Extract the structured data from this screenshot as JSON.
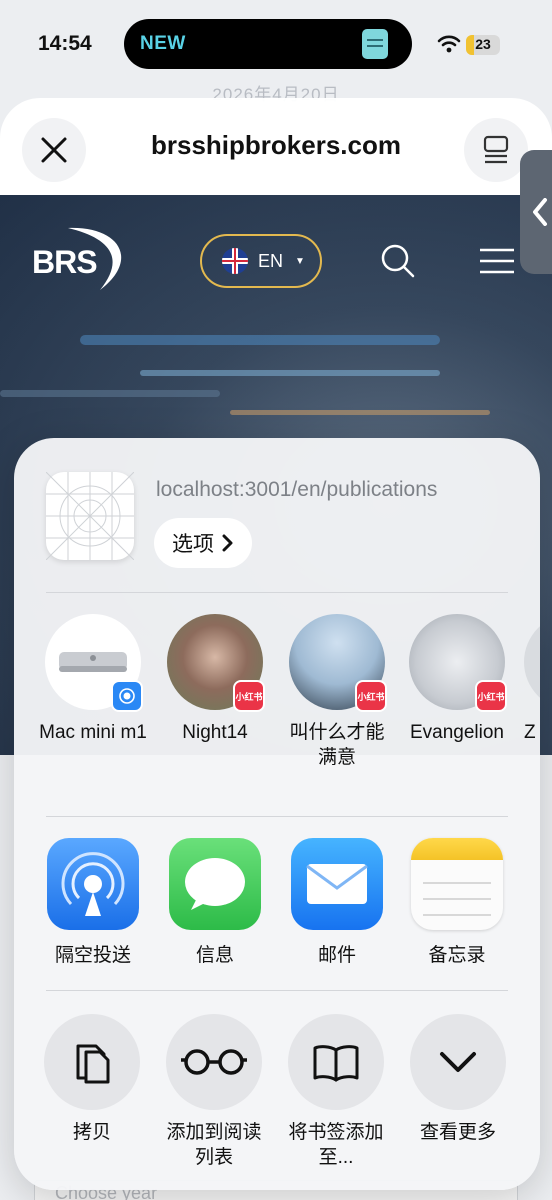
{
  "status_bar": {
    "time": "14:54",
    "island_label": "NEW",
    "battery": "23",
    "battery_level": 0.23
  },
  "background": {
    "date": "2026年4月20日",
    "bottom_field_placeholder": "Choose year"
  },
  "browser": {
    "domain": "brsshipbrokers.com"
  },
  "site_nav": {
    "logo_text": "BRS",
    "language": "EN"
  },
  "share_sheet": {
    "url": "localhost:3001/en/publications",
    "options_label": "选项",
    "contacts": [
      {
        "name": "Mac mini m1",
        "app": "airdrop"
      },
      {
        "name": "Night14",
        "app": "小红书"
      },
      {
        "name": "叫什么才能满意",
        "app": "小红书"
      },
      {
        "name": "Evangelion",
        "app": "小红书"
      },
      {
        "name": "Z"
      }
    ],
    "apps": [
      {
        "label": "隔空投送",
        "icon": "airdrop-icon"
      },
      {
        "label": "信息",
        "icon": "messages-icon"
      },
      {
        "label": "邮件",
        "icon": "mail-icon"
      },
      {
        "label": "备忘录",
        "icon": "notes-icon"
      }
    ],
    "actions": [
      {
        "label": "拷贝",
        "icon": "copy-icon"
      },
      {
        "label": "添加到阅读列表",
        "icon": "reading-list-icon"
      },
      {
        "label": "将书签添加至...",
        "icon": "bookmark-book-icon"
      },
      {
        "label": "查看更多",
        "icon": "chevron-down-icon"
      }
    ]
  },
  "colors": {
    "accent_gold": "#e3b94f",
    "badge_red": "#ea3447",
    "airdrop_blue": "#2a88f5",
    "messages_green": "#4cd964"
  }
}
